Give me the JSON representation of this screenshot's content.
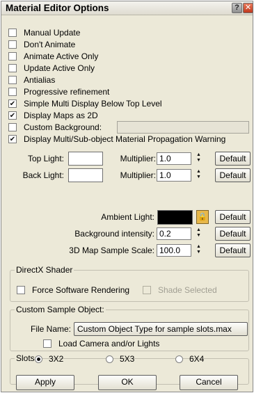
{
  "window": {
    "title": "Material Editor Options",
    "help_glyph": "?",
    "close_glyph": "✕"
  },
  "options": [
    {
      "label": "Manual Update",
      "checked": false
    },
    {
      "label": "Don't Animate",
      "checked": false
    },
    {
      "label": "Animate Active Only",
      "checked": false
    },
    {
      "label": "Update Active Only",
      "checked": false
    },
    {
      "label": "Antialias",
      "checked": false
    },
    {
      "label": "Progressive refinement",
      "checked": false
    },
    {
      "label": "Simple Multi Display Below Top Level",
      "checked": true
    },
    {
      "label": "Display Maps as 2D",
      "checked": true
    },
    {
      "label": "Custom Background:",
      "checked": false
    },
    {
      "label": "Display Multi/Sub-object Material Propagation Warning",
      "checked": true
    }
  ],
  "lights": {
    "top_label": "Top Light:",
    "back_label": "Back Light:",
    "top_color": "#ffffff",
    "back_color": "#ffffff",
    "multiplier_label": "Multiplier:",
    "top_multiplier": "1.0",
    "back_multiplier": "1.0",
    "default_label": "Default",
    "ambient_label": "Ambient Light:",
    "ambient_color": "#000000",
    "bg_intensity_label": "Background intensity:",
    "bg_intensity": "0.2",
    "map_scale_label": "3D Map Sample Scale:",
    "map_scale": "100.0"
  },
  "directx": {
    "title": "DirectX Shader",
    "force_label": "Force Software Rendering",
    "shade_label": "Shade Selected"
  },
  "custom_sample": {
    "title": "Custom Sample Object:",
    "file_label": "File Name:",
    "file_value": "Custom Object Type for sample slots.max",
    "load_label": "Load Camera and/or Lights"
  },
  "slots": {
    "title": "Slots",
    "options": [
      "3X2",
      "5X3",
      "6X4"
    ],
    "selected": "3X2"
  },
  "buttons": {
    "apply": "Apply",
    "ok": "OK",
    "cancel": "Cancel"
  },
  "colors": {
    "dialog_bg": "#ece9d8",
    "lock_accent": "#e8b84a",
    "close_red": "#c0391d"
  },
  "icons": {
    "lock": "lock-icon",
    "spinner": "spinner-arrows-icon",
    "help": "help-icon",
    "close": "close-icon"
  }
}
